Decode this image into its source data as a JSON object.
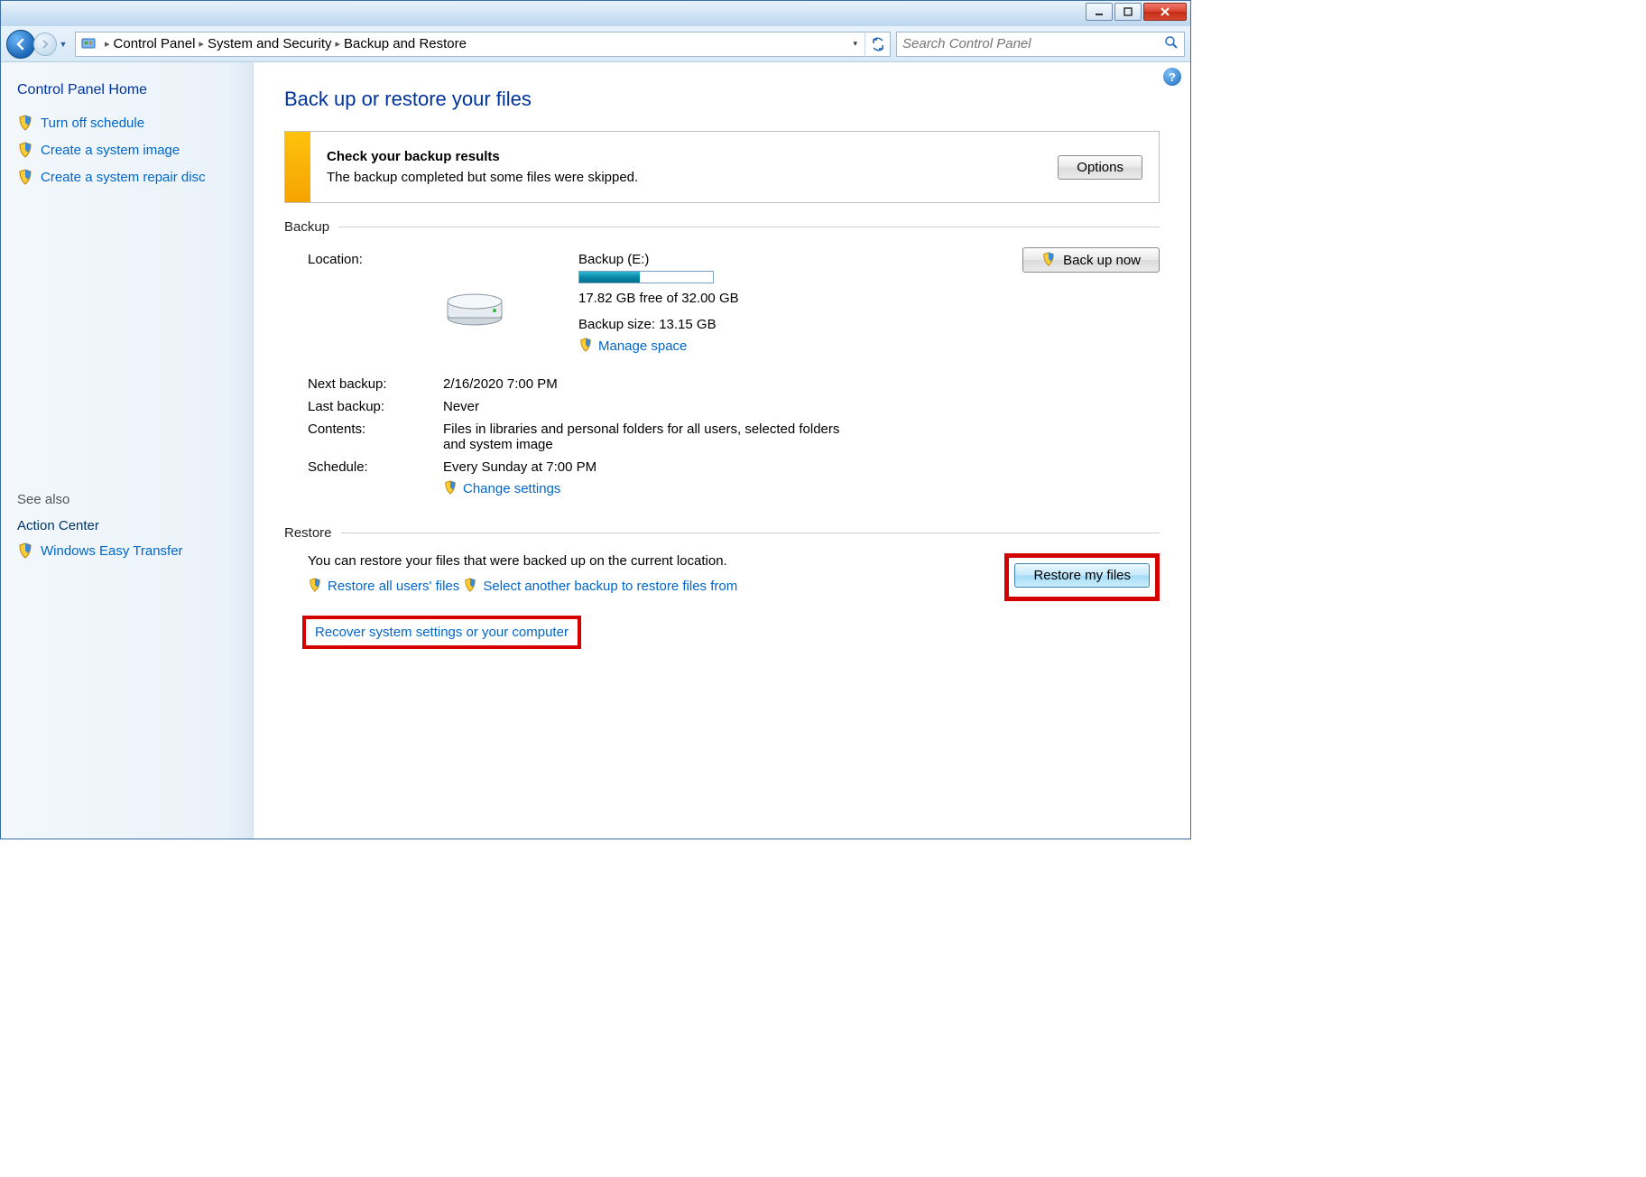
{
  "breadcrumb": {
    "root": "Control Panel",
    "level1": "System and Security",
    "level2": "Backup and Restore"
  },
  "search": {
    "placeholder": "Search Control Panel"
  },
  "sidebar": {
    "home": "Control Panel Home",
    "links": [
      "Turn off schedule",
      "Create a system image",
      "Create a system repair disc"
    ],
    "see_also_label": "See also",
    "see_also": [
      "Action Center",
      "Windows Easy Transfer"
    ]
  },
  "page": {
    "title": "Back up or restore your files"
  },
  "alert": {
    "heading": "Check your backup results",
    "body": "The backup completed but some files were skipped.",
    "button": "Options"
  },
  "backup": {
    "section": "Backup",
    "location_label": "Location:",
    "location_name": "Backup (E:)",
    "free_space": "17.82 GB free of 32.00 GB",
    "progress_pct": 45,
    "size": "Backup size: 13.15 GB",
    "manage_link": "Manage space",
    "backup_now": "Back up now",
    "next_label": "Next backup:",
    "next_value": "2/16/2020 7:00 PM",
    "last_label": "Last backup:",
    "last_value": "Never",
    "contents_label": "Contents:",
    "contents_value": "Files in libraries and personal folders for all users, selected folders and system image",
    "schedule_label": "Schedule:",
    "schedule_value": "Every Sunday at 7:00 PM",
    "change_link": "Change settings"
  },
  "restore": {
    "section": "Restore",
    "description": "You can restore your files that were backed up on the current location.",
    "restore_all": "Restore all users' files",
    "select_another": "Select another backup to restore files from",
    "recover": "Recover system settings or your computer",
    "button": "Restore my files"
  }
}
